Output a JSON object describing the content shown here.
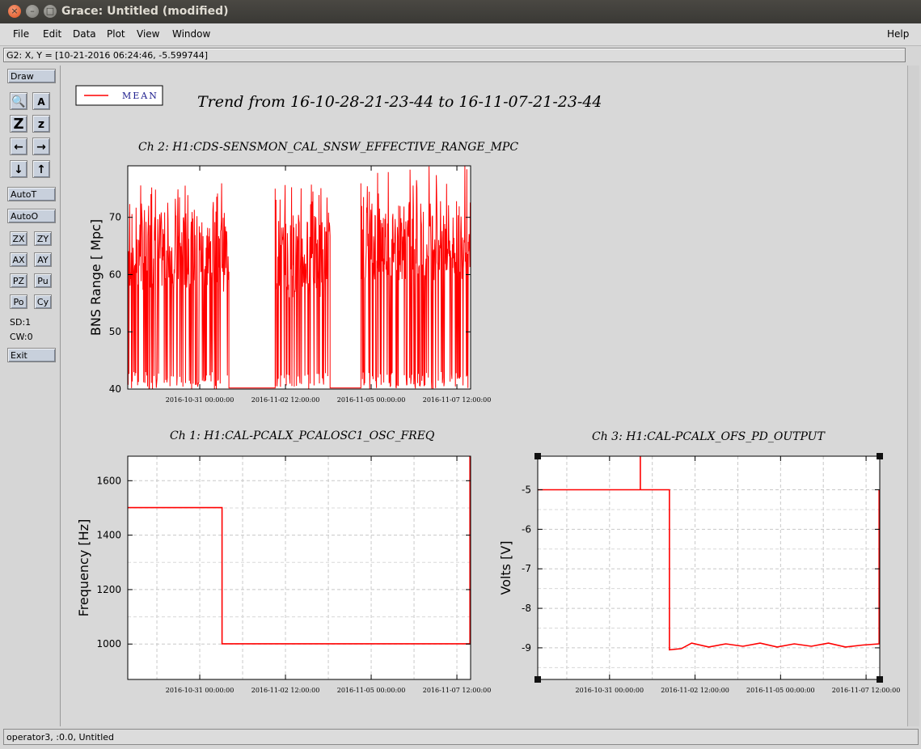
{
  "window": {
    "title": "Grace: Untitled (modified)",
    "close_glyph": "×",
    "minimize_glyph": "–",
    "maximize_glyph": "□"
  },
  "menubar": {
    "items": [
      {
        "label": "File"
      },
      {
        "label": "Edit"
      },
      {
        "label": "Data"
      },
      {
        "label": "Plot"
      },
      {
        "label": "View"
      },
      {
        "label": "Window"
      }
    ],
    "help": "Help"
  },
  "locator": "G2: X, Y = [10-21-2016 06:24:46, -5.599744]",
  "toolbar": {
    "draw": "Draw",
    "autot": "AutoT",
    "autoo": "AutoO",
    "exit": "Exit",
    "icons": {
      "zoom": "magnifier-icon",
      "text": "text-annotation-icon",
      "zoomx": "zoom-z-large-icon",
      "zoomy": "zoom-z-small-icon",
      "left": "arrow-left-icon",
      "right": "arrow-right-icon",
      "down": "arrow-down-icon",
      "up": "arrow-up-icon"
    },
    "glyphs": {
      "zoom": "🔍",
      "text": "A",
      "zbig": "Z",
      "zsmall": "z",
      "left": "←",
      "right": "→",
      "down": "↓",
      "up": "↑"
    },
    "small_buttons": [
      "ZX",
      "ZY",
      "AX",
      "AY",
      "PZ",
      "Pu",
      "Po",
      "Cy"
    ],
    "sd": "SD:1",
    "cw": "CW:0"
  },
  "legend": {
    "label": "MEAN",
    "color": "#ff0000"
  },
  "page_title": "Trend from 16-10-28-21-23-44 to 16-11-07-21-23-44",
  "status": "operator3, :0.0, Untitled",
  "chart_data": [
    {
      "type": "line",
      "title": "Ch 2: H1:CDS-SENSMON_CAL_SNSW_EFFECTIVE_RANGE_MPC",
      "ylabel": "BNS Range [ Mpc]",
      "xlabel": "",
      "xticks": [
        "2016-10-31 00:00:00",
        "2016-11-02 12:00:00",
        "2016-11-05 00:00:00",
        "2016-11-07 12:00:00"
      ],
      "yticks": [
        40,
        50,
        60,
        70
      ],
      "ylim": [
        40,
        79
      ],
      "grid": false,
      "series": [
        {
          "name": "MEAN",
          "color": "#ff0000",
          "segments": [
            {
              "x0": 0.0,
              "x1": 0.295,
              "center": 64,
              "lo": 40,
              "hi": 77
            },
            {
              "x0": 0.43,
              "x1": 0.59,
              "center": 63,
              "lo": 40,
              "hi": 76
            },
            {
              "x0": 0.68,
              "x1": 1.0,
              "center": 66,
              "lo": 40,
              "hi": 79
            }
          ]
        }
      ]
    },
    {
      "type": "line",
      "title": "Ch 1: H1:CAL-PCALX_PCALOSC1_OSC_FREQ",
      "ylabel": "Frequency [Hz]",
      "xlabel": "",
      "xticks": [
        "2016-10-31 00:00:00",
        "2016-11-02 12:00:00",
        "2016-11-05 00:00:00",
        "2016-11-07 12:00:00"
      ],
      "yticks": [
        1000,
        1200,
        1400,
        1600
      ],
      "ylim": [
        870,
        1690
      ],
      "grid": true,
      "series": [
        {
          "name": "MEAN",
          "color": "#ff0000",
          "points": [
            [
              0,
              1501
            ],
            [
              0.275,
              1501
            ],
            [
              0.275,
              1001
            ],
            [
              0.96,
              1001
            ],
            [
              0.96,
              1001
            ],
            [
              0.998,
              1001
            ],
            [
              0.998,
              1690
            ]
          ]
        }
      ]
    },
    {
      "type": "line",
      "title": "Ch 3: H1:CAL-PCALX_OFS_PD_OUTPUT",
      "ylabel": "Volts [V]",
      "xlabel": "",
      "xticks": [
        "2016-10-31 00:00:00",
        "2016-11-02 12:00:00",
        "2016-11-05 00:00:00",
        "2016-11-07 12:00:00"
      ],
      "yticks": [
        -5,
        -6,
        -7,
        -8,
        -9
      ],
      "ylim": [
        -9.8,
        -4.15
      ],
      "grid": true,
      "series": [
        {
          "name": "MEAN",
          "color": "#ff0000",
          "points": [
            [
              0,
              -5
            ],
            [
              0.3,
              -5
            ],
            [
              0.3,
              -4.15
            ],
            [
              0.3,
              -5
            ],
            [
              0.385,
              -5
            ],
            [
              0.385,
              -9.05
            ],
            [
              0.42,
              -9.02
            ],
            [
              0.45,
              -8.88
            ],
            [
              0.5,
              -8.98
            ],
            [
              0.55,
              -8.9
            ],
            [
              0.6,
              -8.96
            ],
            [
              0.65,
              -8.88
            ],
            [
              0.7,
              -8.98
            ],
            [
              0.75,
              -8.9
            ],
            [
              0.8,
              -8.96
            ],
            [
              0.85,
              -8.88
            ],
            [
              0.9,
              -8.98
            ],
            [
              0.95,
              -8.93
            ],
            [
              0.998,
              -8.9
            ],
            [
              0.998,
              -5
            ]
          ]
        }
      ]
    }
  ]
}
